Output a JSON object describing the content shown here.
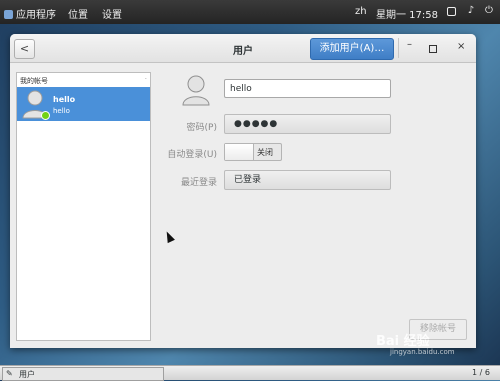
{
  "topbar": {
    "apps": "应用程序",
    "places": "位置",
    "settings": "设置",
    "lang": "zh",
    "clock": "星期一 17:58",
    "power_icon": "power-icon",
    "volume_icon": "volume-icon"
  },
  "window": {
    "title": "用户",
    "back_icon": "<",
    "add_user": "添加用户(A)…",
    "minimize": "–",
    "close": "×"
  },
  "sidebar": {
    "header": "我的帐号",
    "header_mark": "·",
    "users": [
      {
        "name": "hello",
        "login": "hello",
        "status_color": "#73d216"
      }
    ]
  },
  "details": {
    "username": "hello",
    "password_label": "密码(P)",
    "password_value": "●●●●●",
    "autologin_label": "自动登录(U)",
    "autologin_state": "关闭",
    "lastlogin_label": "最近登录",
    "lastlogin_value": "已登录",
    "remove_button": "移除帐号"
  },
  "watermark": {
    "text": "Bai 经验",
    "url": "jingyan.baidu.com"
  },
  "taskbar": {
    "app_label": "用户",
    "workspace": "1 / 6"
  },
  "colors": {
    "accent": "#4a90d9",
    "online": "#73d216"
  }
}
